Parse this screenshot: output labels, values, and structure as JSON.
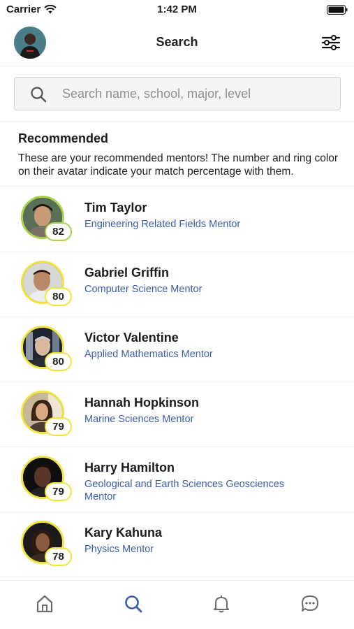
{
  "status_bar": {
    "carrier": "Carrier",
    "time": "1:42 PM"
  },
  "nav": {
    "title": "Search"
  },
  "search": {
    "placeholder": "Search name, school, major, level"
  },
  "recommended": {
    "heading": "Recommended",
    "description": "These are your recommended mentors! The number and ring color on their avatar indicate your match percentage with them."
  },
  "colors": {
    "accent": "#3b5cab",
    "ring_yellow": "#f0e43a",
    "ring_green": "#a8d24a"
  },
  "mentors": [
    {
      "name": "Tim Taylor",
      "major": "Engineering Related Fields Mentor",
      "score": "82",
      "ring": "green"
    },
    {
      "name": "Gabriel Griffin",
      "major": "Computer Science Mentor",
      "score": "80",
      "ring": "yellow"
    },
    {
      "name": "Victor Valentine",
      "major": "Applied Mathematics Mentor",
      "score": "80",
      "ring": "yellow"
    },
    {
      "name": "Hannah Hopkinson",
      "major": "Marine Sciences Mentor",
      "score": "79",
      "ring": "yellow"
    },
    {
      "name": "Harry Hamilton",
      "major": "Geological and Earth Sciences Geosciences Mentor",
      "score": "79",
      "ring": "yellow"
    },
    {
      "name": "Kary Kahuna",
      "major": "Physics Mentor",
      "score": "78",
      "ring": "yellow"
    }
  ],
  "tabs": [
    {
      "icon": "home-icon",
      "active": false
    },
    {
      "icon": "search-icon",
      "active": true
    },
    {
      "icon": "bell-icon",
      "active": false
    },
    {
      "icon": "chat-icon",
      "active": false
    }
  ]
}
